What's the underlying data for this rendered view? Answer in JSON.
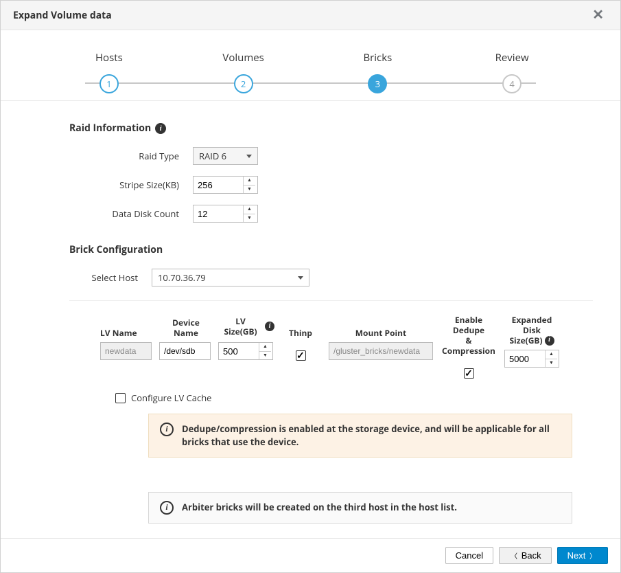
{
  "header": {
    "title": "Expand Volume data"
  },
  "wizard": {
    "steps": [
      {
        "label": "Hosts",
        "num": "1",
        "state": "done"
      },
      {
        "label": "Volumes",
        "num": "2",
        "state": "done"
      },
      {
        "label": "Bricks",
        "num": "3",
        "state": "current"
      },
      {
        "label": "Review",
        "num": "4",
        "state": "todo"
      }
    ]
  },
  "raid": {
    "section_title": "Raid Information",
    "type_label": "Raid Type",
    "type_value": "RAID 6",
    "stripe_label": "Stripe Size(KB)",
    "stripe_value": "256",
    "disk_count_label": "Data Disk Count",
    "disk_count_value": "12"
  },
  "brick": {
    "section_title": "Brick Configuration",
    "select_host_label": "Select Host",
    "select_host_value": "10.70.36.79",
    "columns": {
      "lv_name": "LV Name",
      "device_name": "Device Name",
      "lv_size": "LV Size(GB)",
      "thinp": "Thinp",
      "mount_point": "Mount Point",
      "dedupe_top": "Enable Dedupe",
      "dedupe_bottom": "& Compression",
      "exp_top": "Expanded Disk",
      "exp_bottom": "Size(GB)"
    },
    "row": {
      "lv_name": "newdata",
      "device_name": "/dev/sdb",
      "lv_size": "500",
      "thinp_checked": true,
      "mount_point": "/gluster_bricks/newdata",
      "dedupe_checked": true,
      "expanded_size": "5000"
    },
    "configure_cache_label": "Configure LV Cache",
    "configure_cache_checked": false,
    "dedupe_alert": "Dedupe/compression is enabled at the storage device, and will be applicable for all bricks that use the device.",
    "arbiter_alert": "Arbiter bricks will be created on the third host in the host list."
  },
  "footer": {
    "cancel": "Cancel",
    "back": "Back",
    "next": "Next"
  }
}
